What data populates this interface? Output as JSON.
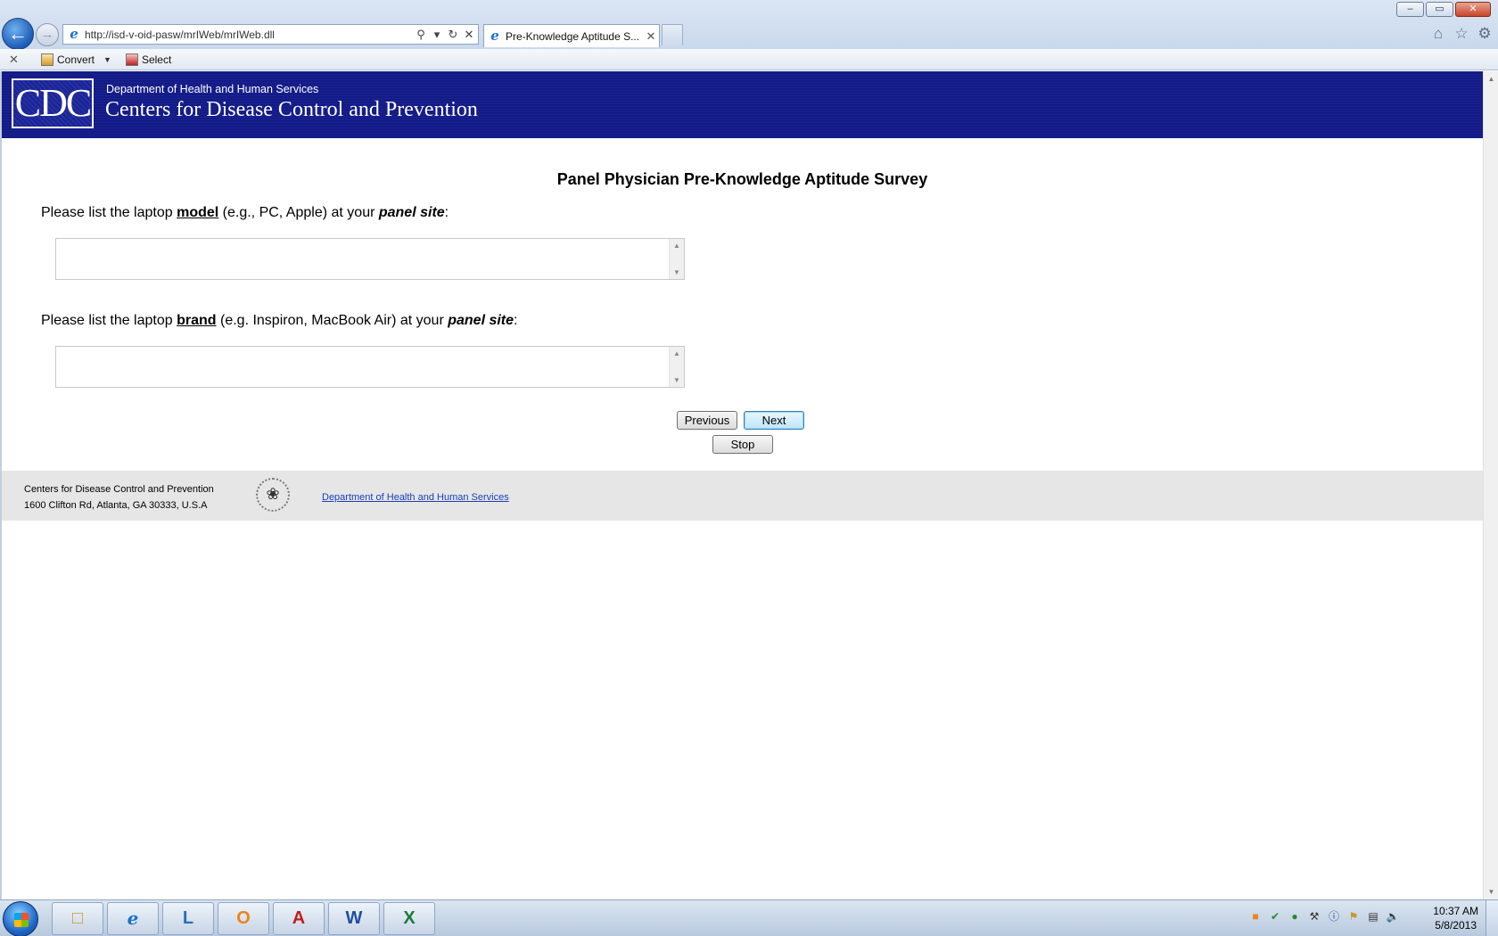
{
  "browser": {
    "url": "http://isd-v-oid-pasw/mrIWeb/mrIWeb.dll",
    "tab_title": "Pre-Knowledge Aptitude S...",
    "window_controls": [
      "–",
      "▭",
      "✕"
    ],
    "commandbar": {
      "convert_label": "Convert",
      "select_label": "Select"
    }
  },
  "header": {
    "logo_text": "CDC",
    "department": "Department of Health and Human Services",
    "agency": "Centers for Disease Control and Prevention"
  },
  "survey": {
    "title": "Panel Physician Pre-Knowledge Aptitude Survey",
    "questions": [
      {
        "prefix": "Please list the laptop ",
        "keyword": "model",
        "middle": " (e.g., PC, Apple) at your ",
        "emphasis": "panel site",
        "suffix": ":",
        "answer": ""
      },
      {
        "prefix": "Please list the laptop ",
        "keyword": "brand",
        "middle": " (e.g. Inspiron, MacBook Air) at your ",
        "emphasis": "panel site",
        "suffix": ":",
        "answer": ""
      }
    ],
    "buttons": {
      "previous": "Previous",
      "next": "Next",
      "stop": "Stop"
    }
  },
  "footer": {
    "address_line1": "Centers for Disease Control and Prevention",
    "address_line2": "1600 Clifton Rd, Atlanta, GA 30333, U.S.A",
    "hhs_link": "Department of Health and Human Services"
  },
  "taskbar": {
    "apps": [
      "file-explorer-icon",
      "internet-explorer-icon",
      "lync-icon",
      "outlook-icon",
      "acrobat-icon",
      "word-icon",
      "excel-icon"
    ],
    "time": "10:37 AM",
    "date": "5/8/2013"
  },
  "colors": {
    "header_blue": "#131a86",
    "footer_gray": "#e6e6e6",
    "link_blue": "#1a3fb8"
  }
}
